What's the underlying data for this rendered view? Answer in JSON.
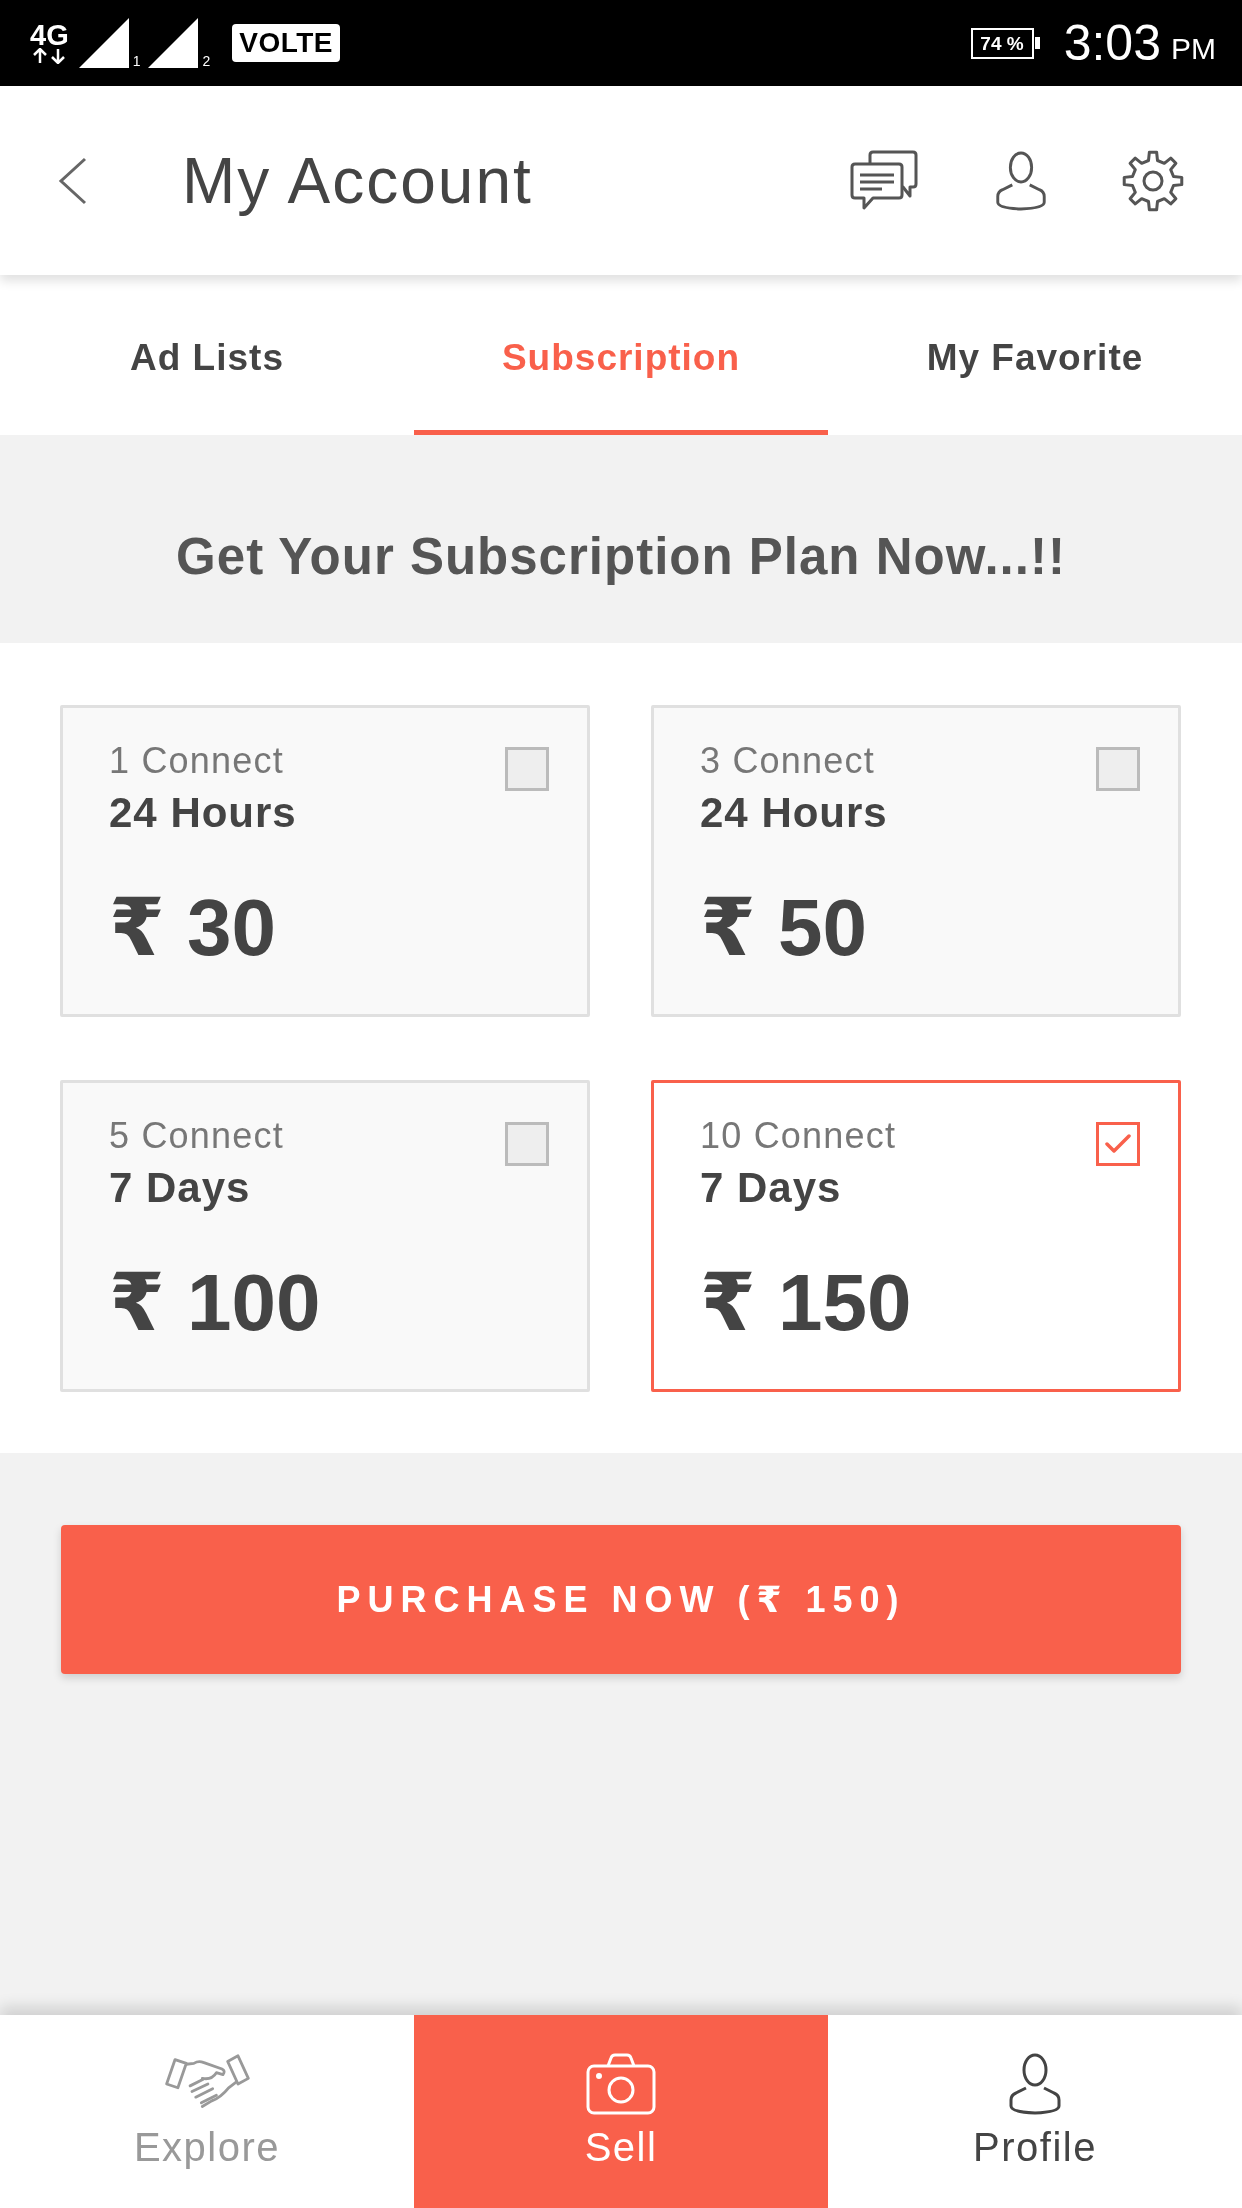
{
  "status_bar": {
    "network": "4G",
    "sim_1": "1",
    "sim_2": "2",
    "volte": "VOLTE",
    "battery": "74 %",
    "time": "3:03",
    "meridiem": "PM"
  },
  "header": {
    "title": "My Account"
  },
  "tabs": [
    {
      "label": "Ad Lists",
      "selected": false
    },
    {
      "label": "Subscription",
      "selected": true
    },
    {
      "label": "My Favorite",
      "selected": false
    }
  ],
  "banner": {
    "text": "Get Your Subscription Plan Now...!!"
  },
  "plans": [
    {
      "connects": "1 Connect",
      "duration": "24 Hours",
      "price": "₹ 30",
      "selected": false
    },
    {
      "connects": "3 Connect",
      "duration": "24 Hours",
      "price": "₹ 50",
      "selected": false
    },
    {
      "connects": "5 Connect",
      "duration": "7 Days",
      "price": "₹ 100",
      "selected": false
    },
    {
      "connects": "10 Connect",
      "duration": "7 Days",
      "price": "₹ 150",
      "selected": true
    }
  ],
  "purchase_button": {
    "label": "PURCHASE NOW (₹ 150)"
  },
  "bottom_nav": [
    {
      "label": "Explore",
      "selected": false,
      "disabled": true
    },
    {
      "label": "Sell",
      "selected": true,
      "disabled": false
    },
    {
      "label": "Profile",
      "selected": false,
      "disabled": false
    }
  ]
}
